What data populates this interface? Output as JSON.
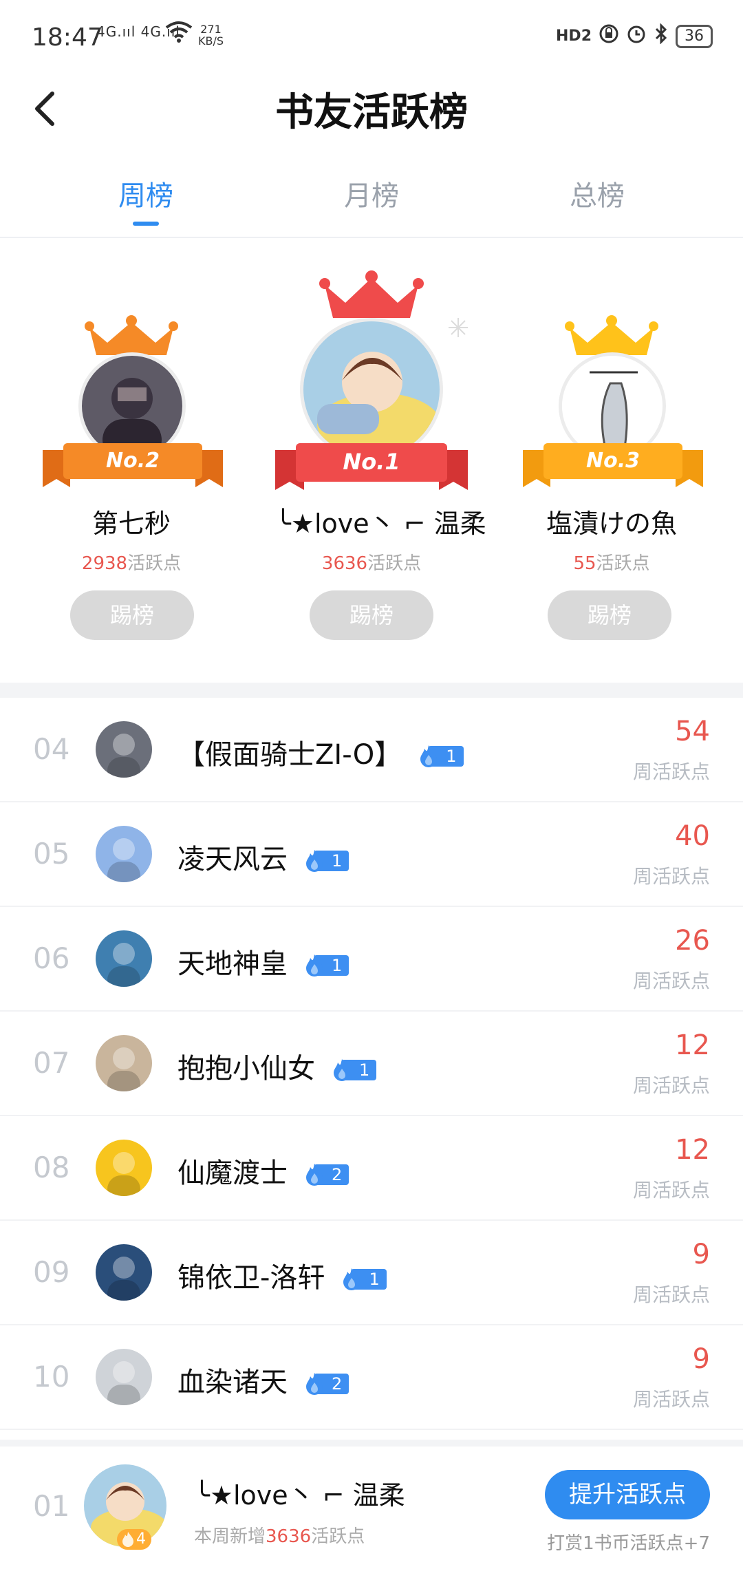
{
  "status": {
    "time": "18:47",
    "network": "4G.ııl 4G.ııl",
    "speed_value": "271",
    "speed_unit": "KB/S",
    "hd": "HD2",
    "battery": "36"
  },
  "nav": {
    "title": "书友活跃榜"
  },
  "tabs": [
    {
      "label": "周榜",
      "active": true
    },
    {
      "label": "月榜",
      "active": false
    },
    {
      "label": "总榜",
      "active": false
    }
  ],
  "podium": {
    "first": {
      "badge": "No.1",
      "name": "╰★love丶 ⌐ 温柔",
      "points": "3636",
      "points_suffix": "活跃点",
      "kick": "踢榜"
    },
    "second": {
      "badge": "No.2",
      "name": "第七秒",
      "points": "2938",
      "points_suffix": "活跃点",
      "kick": "踢榜"
    },
    "third": {
      "badge": "No.3",
      "name": "塩漬けの魚",
      "points": "55",
      "points_suffix": "活跃点",
      "kick": "踢榜"
    }
  },
  "list": [
    {
      "rank": "04",
      "name": "【假面骑士ZI-O】",
      "level": "1",
      "score": "54",
      "score_label": "周活跃点",
      "avatar_color": "#6b6f7a"
    },
    {
      "rank": "05",
      "name": "凌天风云",
      "level": "1",
      "score": "40",
      "score_label": "周活跃点",
      "avatar_color": "#8fb4e8"
    },
    {
      "rank": "06",
      "name": "天地神皇",
      "level": "1",
      "score": "26",
      "score_label": "周活跃点",
      "avatar_color": "#3f7fb0"
    },
    {
      "rank": "07",
      "name": "抱抱小仙女",
      "level": "1",
      "score": "12",
      "score_label": "周活跃点",
      "avatar_color": "#c9b59c"
    },
    {
      "rank": "08",
      "name": "仙魔渡士",
      "level": "2",
      "score": "12",
      "score_label": "周活跃点",
      "avatar_color": "#f7c51e"
    },
    {
      "rank": "09",
      "name": "锦依卫-洛轩",
      "level": "1",
      "score": "9",
      "score_label": "周活跃点",
      "avatar_color": "#2a4e7a"
    },
    {
      "rank": "10",
      "name": "血染诸天",
      "level": "2",
      "score": "9",
      "score_label": "周活跃点",
      "avatar_color": "#cfd3d8"
    }
  ],
  "me": {
    "rank": "01",
    "name": "╰★love丶 ⌐ 温柔",
    "level": "4",
    "sub_prefix": "本周新增",
    "sub_points": "3636",
    "sub_suffix": "活跃点",
    "boost_label": "提升活跃点",
    "reward_note": "打赏1书币活跃点+7"
  },
  "colors": {
    "accent": "#2f8cf0",
    "score": "#e8574f",
    "gold": "#ffad1f",
    "red_ribbon": "#ef4b4b",
    "orange_ribbon": "#f58a27"
  }
}
